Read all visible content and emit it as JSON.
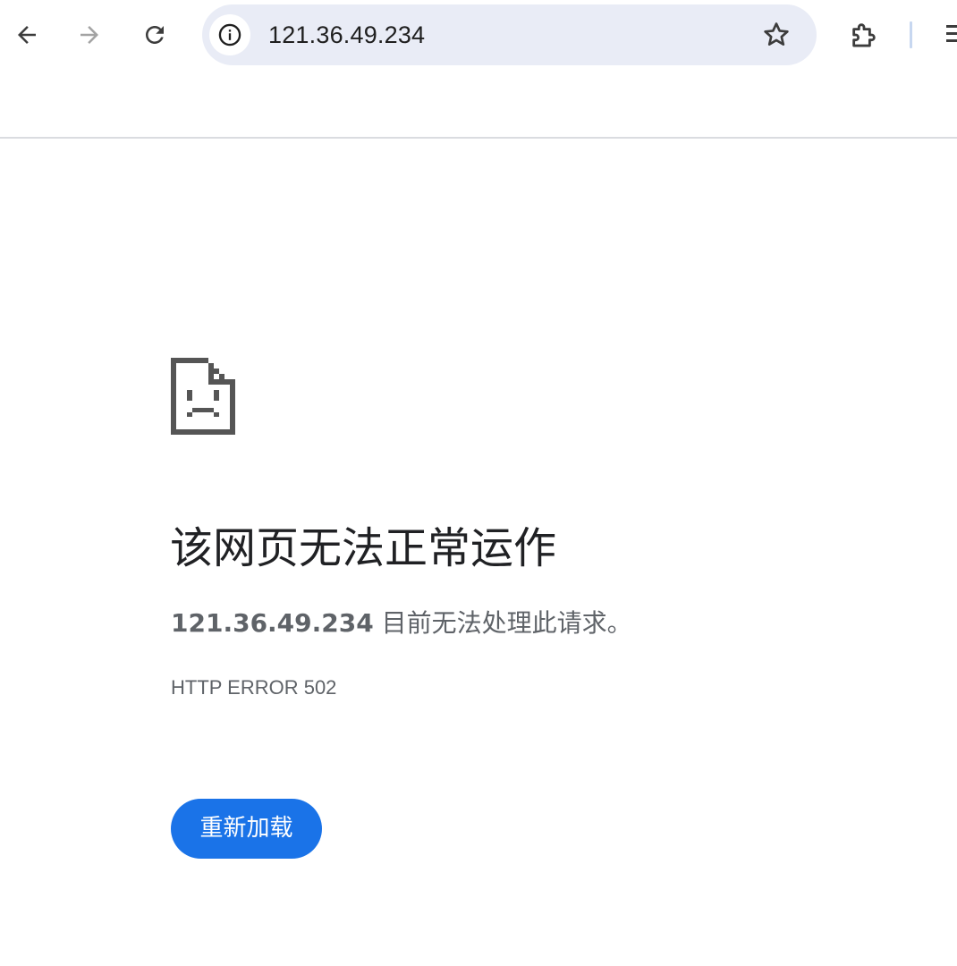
{
  "toolbar": {
    "back_icon": "arrow-left-icon",
    "forward_icon": "arrow-right-icon",
    "reload_icon": "reload-icon",
    "extensions_icon": "puzzle-icon",
    "menu_icon": "menu-icon"
  },
  "omnibox": {
    "url": "121.36.49.234",
    "info_icon": "info-icon",
    "bookmark_icon": "star-icon"
  },
  "error_page": {
    "icon": "sad-document-icon",
    "heading": "该网页无法正常运作",
    "host": "121.36.49.234",
    "message": " 目前无法处理此请求。",
    "error_code": "HTTP ERROR 502",
    "reload_label": "重新加载"
  },
  "colors": {
    "accent": "#1a73e8",
    "omnibox_bg": "#e9ecf6",
    "text_primary": "#202124",
    "text_secondary": "#5f6368"
  }
}
